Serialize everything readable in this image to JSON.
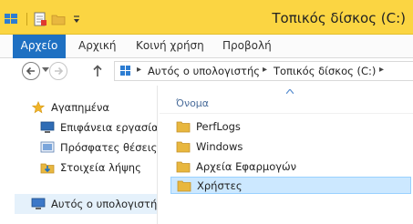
{
  "window": {
    "title": "Τοπικός δίσκος (C:)"
  },
  "quick_access": {
    "icons": [
      "explorer-icon",
      "properties-icon",
      "new-folder-icon",
      "customize-arrow-icon"
    ]
  },
  "ribbon": {
    "tabs": [
      {
        "label": "Αρχείο",
        "active": true
      },
      {
        "label": "Αρχική",
        "active": false
      },
      {
        "label": "Κοινή χρήση",
        "active": false
      },
      {
        "label": "Προβολή",
        "active": false
      }
    ]
  },
  "address": {
    "segments": [
      "Αυτός ο υπολογιστής",
      "Τοπικός δίσκος (C:)"
    ]
  },
  "sidebar": {
    "items": [
      {
        "label": "Αγαπημένα",
        "icon": "star-icon"
      },
      {
        "label": "Επιφάνεια εργασίας",
        "icon": "desktop-icon"
      },
      {
        "label": "Πρόσφατες θέσεις",
        "icon": "recent-places-icon"
      },
      {
        "label": "Στοιχεία λήψης",
        "icon": "downloads-icon"
      },
      {
        "label": "Αυτός ο υπολογιστής",
        "icon": "computer-icon",
        "selected": true
      }
    ]
  },
  "content": {
    "column_header": "Όνομα",
    "sort_direction": "ascending",
    "files": [
      {
        "name": "PerfLogs",
        "icon": "folder-icon"
      },
      {
        "name": "Windows",
        "icon": "folder-icon"
      },
      {
        "name": "Αρχεία Εφαρμογών",
        "icon": "folder-icon"
      },
      {
        "name": "Χρήστες",
        "icon": "folder-icon",
        "selected": true
      }
    ]
  },
  "colors": {
    "titlebar": "#fbd542",
    "file_tab": "#1e70c2",
    "selection": "#cce8ff",
    "folder": "#e8b73f"
  }
}
